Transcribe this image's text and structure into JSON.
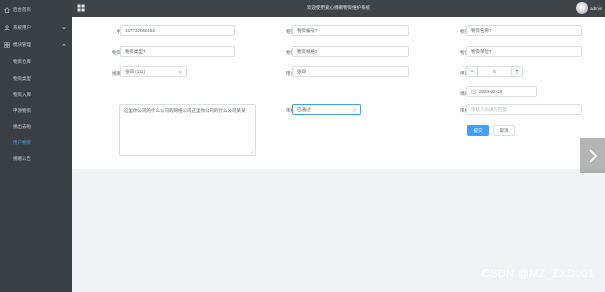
{
  "header": {
    "title": "欢迎使用爱心捐赠物资维护系统",
    "username": "admin"
  },
  "sidebar": {
    "items": [
      {
        "label": "后台首页",
        "icon": "home-icon"
      },
      {
        "label": "系统用户",
        "icon": "user-icon"
      },
      {
        "label": "模块管理",
        "icon": "grid-icon"
      },
      {
        "label": "物资仓库"
      },
      {
        "label": "物资类型"
      },
      {
        "label": "物资入库"
      },
      {
        "label": "申领物资"
      },
      {
        "label": "捐出去啦"
      },
      {
        "label": "用户物资"
      },
      {
        "label": "捐赠公告"
      }
    ]
  },
  "form": {
    "labels": {
      "phone": "手机号",
      "goods_code": "物资编号",
      "goods_name": "物资名称",
      "goods_type": "物资类型",
      "goods_spec": "物资规格",
      "goods_unit": "物资单位",
      "donor": "捐赠用户",
      "user_name": "用户姓名",
      "quantity": "申领数量",
      "apply_date": "捐赠日期",
      "remark": "备注",
      "audit_status": "审核状态",
      "audit_reply": "审核回复"
    },
    "values": {
      "phone": "15773206016S",
      "goods_code": "物资编号7",
      "goods_name": "物资名称7",
      "goods_type": "物资类型7",
      "goods_spec": "物资规格7",
      "goods_unit": "物资单位7",
      "donor": "张四 (111)",
      "user_name": "张四",
      "quantity": "5",
      "apply_date": "2023-02-19",
      "remark": "这里你公司的什么公司的网络公司这里你公司的什么公司某某",
      "audit_status": "已通过"
    },
    "placeholders": {
      "audit_reply": "审核人员填写回复"
    },
    "buttons": {
      "submit": "提交",
      "cancel": "取消"
    }
  },
  "watermark": "CSDN @MZ_ZXD001",
  "colors": {
    "sidebar_bg": "#3a3f44",
    "header_bg": "#3f4449",
    "primary": "#409eff",
    "active_nav": "#409eff"
  }
}
